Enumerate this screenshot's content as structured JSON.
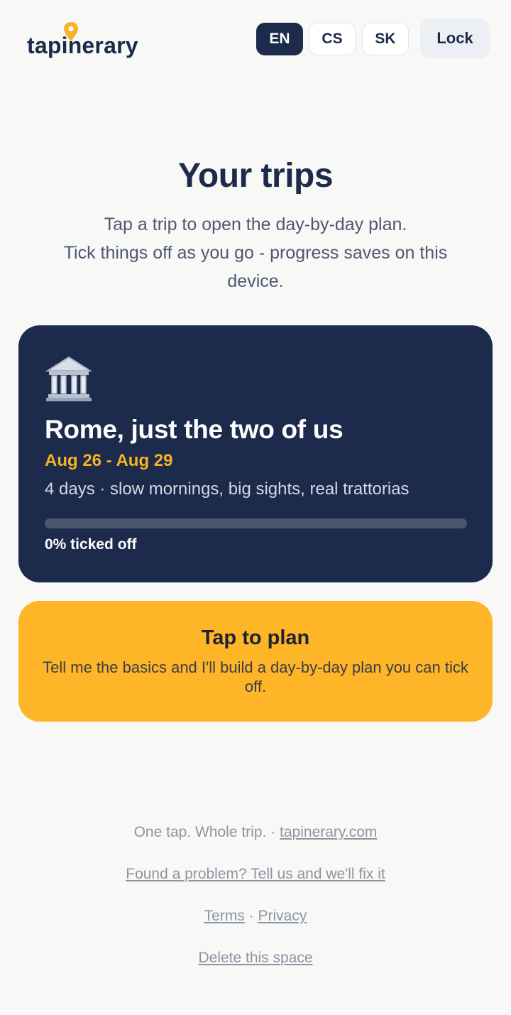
{
  "header": {
    "logo_text": "tapinerary",
    "languages": [
      "EN",
      "CS",
      "SK"
    ],
    "active_language": "EN",
    "lock_label": "Lock"
  },
  "hero": {
    "title": "Your trips",
    "subtitle_line1": "Tap a trip to open the day-by-day plan.",
    "subtitle_line2": "Tick things off as you go - progress saves on this device."
  },
  "trip": {
    "icon": "classical-building-icon",
    "name": "Rome, just the two of us",
    "dates": "Aug 26 - Aug 29",
    "description": "4 days · slow mornings, big sights, real trattorias",
    "progress_fraction": 0,
    "progress_label": "0% ticked off"
  },
  "plan_card": {
    "title": "Tap to plan",
    "description": "Tell me the basics and I'll build a day-by-day plan you can tick off."
  },
  "footer": {
    "tagline": "One tap. Whole trip.",
    "separator": "·",
    "site_link": "tapinerary.com",
    "feedback_link": "Found a problem? Tell us and we'll fix it",
    "terms_link": "Terms",
    "privacy_link": "Privacy",
    "delete_link": "Delete this space"
  },
  "colors": {
    "navy": "#1c2a4b",
    "accent_yellow": "#feb528",
    "date_yellow": "#f5b325",
    "background": "#f8f8f6"
  }
}
